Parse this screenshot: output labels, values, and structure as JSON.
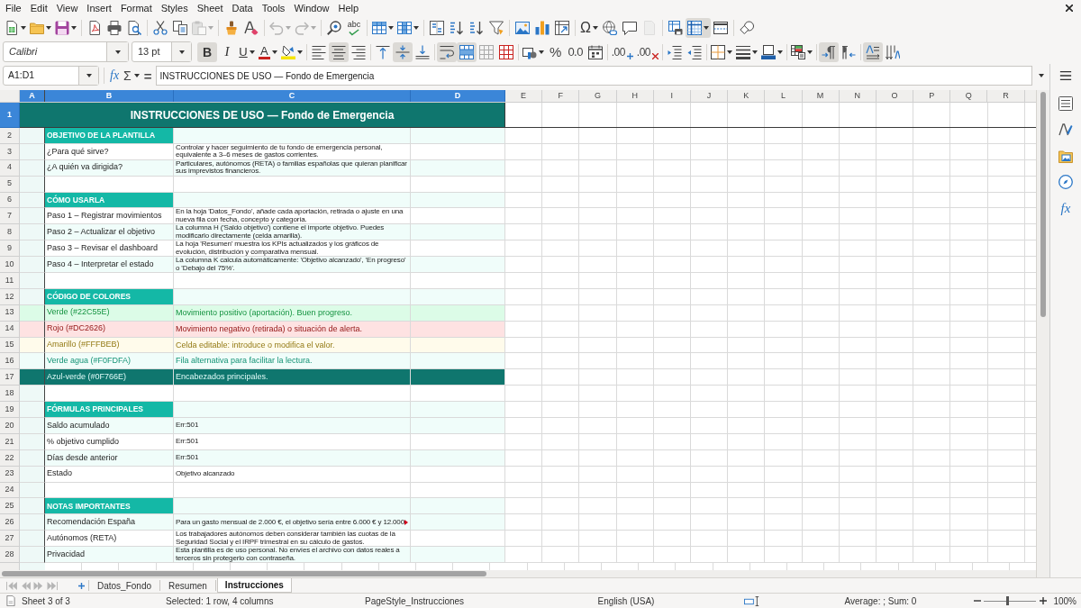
{
  "menu_bar": {
    "items": [
      "File",
      "Edit",
      "View",
      "Insert",
      "Format",
      "Styles",
      "Sheet",
      "Data",
      "Tools",
      "Window",
      "Help"
    ]
  },
  "standard_toolbar": {
    "groups": [
      [
        {
          "kind": "new",
          "dropdown": true,
          "disabled": false,
          "active": false
        },
        {
          "kind": "open",
          "dropdown": true,
          "disabled": false,
          "active": false
        },
        {
          "kind": "save",
          "dropdown": true,
          "disabled": false,
          "active": false
        }
      ],
      [
        {
          "kind": "pdf",
          "dropdown": false,
          "disabled": false,
          "active": false
        },
        {
          "kind": "print",
          "dropdown": false,
          "disabled": false,
          "active": false
        },
        {
          "kind": "preview",
          "dropdown": false,
          "disabled": false,
          "active": false
        }
      ],
      [
        {
          "kind": "cut",
          "dropdown": false,
          "disabled": false,
          "active": false
        },
        {
          "kind": "copy",
          "dropdown": false,
          "disabled": false,
          "active": false
        },
        {
          "kind": "paste",
          "dropdown": true,
          "disabled": true,
          "active": false
        }
      ],
      [
        {
          "kind": "clone",
          "dropdown": false,
          "disabled": false,
          "active": false
        },
        {
          "kind": "clear",
          "dropdown": false,
          "disabled": false,
          "active": false
        }
      ],
      [
        {
          "kind": "undo",
          "dropdown": true,
          "disabled": true,
          "active": false
        },
        {
          "kind": "redo",
          "dropdown": true,
          "disabled": true,
          "active": false
        }
      ],
      [
        {
          "kind": "find",
          "dropdown": false,
          "disabled": false,
          "active": false
        },
        {
          "kind": "spelling",
          "label": "abc",
          "dropdown": false,
          "disabled": false,
          "active": false
        }
      ],
      [
        {
          "kind": "rows",
          "dropdown": true,
          "disabled": false,
          "active": false
        },
        {
          "kind": "columns",
          "dropdown": true,
          "disabled": false,
          "active": false
        }
      ],
      [
        {
          "kind": "sort",
          "dropdown": false,
          "disabled": false,
          "active": false
        },
        {
          "kind": "sortup",
          "dropdown": false,
          "disabled": false,
          "active": false
        },
        {
          "kind": "sortdown",
          "dropdown": false,
          "disabled": false,
          "active": false
        },
        {
          "kind": "filter",
          "dropdown": false,
          "disabled": false,
          "active": false
        }
      ],
      [
        {
          "kind": "image",
          "dropdown": false,
          "disabled": false,
          "active": false
        },
        {
          "kind": "chart",
          "dropdown": false,
          "disabled": false,
          "active": false
        },
        {
          "kind": "pivot",
          "dropdown": false,
          "disabled": false,
          "active": false
        }
      ],
      [
        {
          "kind": "special",
          "label": "Ω",
          "dropdown": true,
          "disabled": false,
          "active": false
        },
        {
          "kind": "hyperlink",
          "dropdown": false,
          "disabled": false,
          "active": false
        },
        {
          "kind": "comment",
          "dropdown": false,
          "disabled": false,
          "active": false
        },
        {
          "kind": "header",
          "dropdown": false,
          "disabled": true,
          "active": false
        }
      ],
      [
        {
          "kind": "printarea",
          "dropdown": false,
          "disabled": false,
          "active": false
        },
        {
          "kind": "freeze",
          "dropdown": true,
          "disabled": false,
          "active": true
        },
        {
          "kind": "split",
          "dropdown": false,
          "disabled": false,
          "active": false
        }
      ],
      [
        {
          "kind": "draw",
          "dropdown": false,
          "disabled": false,
          "active": false
        }
      ]
    ]
  },
  "formatting_toolbar": {
    "font_name": "Calibri",
    "font_size": "13 pt",
    "groups": [
      [
        {
          "kind": "bold",
          "label": "B",
          "dropdown": false,
          "active": true
        },
        {
          "kind": "italic",
          "label": "I",
          "dropdown": false,
          "active": false
        },
        {
          "kind": "underline",
          "label": "U",
          "dropdown": true,
          "active": false
        },
        {
          "kind": "fontcolor",
          "label": "A",
          "dropdown": true,
          "active": false
        },
        {
          "kind": "highlight",
          "dropdown": true,
          "active": false
        }
      ],
      [
        {
          "kind": "alignleft",
          "dropdown": false,
          "active": false
        },
        {
          "kind": "aligncenter",
          "dropdown": false,
          "active": true
        },
        {
          "kind": "alignright",
          "dropdown": false,
          "active": false
        }
      ],
      [
        {
          "kind": "aligntop",
          "dropdown": false,
          "active": false
        },
        {
          "kind": "alignmiddle",
          "dropdown": false,
          "active": true
        },
        {
          "kind": "alignbottom",
          "dropdown": false,
          "active": false
        }
      ],
      [
        {
          "kind": "wrap",
          "dropdown": false,
          "active": true
        },
        {
          "kind": "mergecenter",
          "dropdown": false,
          "active": true
        },
        {
          "kind": "merge",
          "dropdown": false,
          "active": false
        },
        {
          "kind": "unmerge",
          "dropdown": false,
          "active": false
        }
      ],
      [
        {
          "kind": "currency",
          "dropdown": true,
          "active": false
        },
        {
          "kind": "percent",
          "label": "%",
          "dropdown": false,
          "active": false
        },
        {
          "kind": "number",
          "label": "0.0",
          "dropdown": false,
          "active": false
        },
        {
          "kind": "date",
          "dropdown": false,
          "active": false
        }
      ],
      [
        {
          "kind": "adddecimal",
          "label": ".00",
          "dropdown": false,
          "active": false
        },
        {
          "kind": "deldecimal",
          "label": ".00",
          "dropdown": false,
          "active": false
        }
      ],
      [
        {
          "kind": "indent",
          "dropdown": false,
          "active": false
        },
        {
          "kind": "outdent",
          "dropdown": false,
          "active": false
        }
      ],
      [
        {
          "kind": "borders",
          "dropdown": true,
          "active": false
        },
        {
          "kind": "borderstyle",
          "dropdown": true,
          "active": false
        },
        {
          "kind": "bordercolor",
          "dropdown": true,
          "active": false
        }
      ],
      [
        {
          "kind": "conditional",
          "dropdown": true,
          "active": false
        }
      ],
      [
        {
          "kind": "ltr",
          "dropdown": false,
          "active": true
        },
        {
          "kind": "rtl",
          "dropdown": false,
          "active": false
        }
      ],
      [
        {
          "kind": "textltr",
          "dropdown": false,
          "active": true
        },
        {
          "kind": "textttb",
          "dropdown": false,
          "active": false
        }
      ]
    ]
  },
  "formula_bar": {
    "name_box": "A1:D1",
    "wizard_glyph": "fx",
    "sum_glyph": "Σ",
    "formula_glyph": "=",
    "content": "INSTRUCCIONES DE USO — Fondo de Emergencia"
  },
  "sidebar": {
    "functions_glyph": "fx"
  },
  "sheet": {
    "columns": [
      {
        "label": "A",
        "selected": true
      },
      {
        "label": "B",
        "selected": true
      },
      {
        "label": "C",
        "selected": true
      },
      {
        "label": "D",
        "selected": true
      },
      {
        "label": "E",
        "selected": false
      },
      {
        "label": "F",
        "selected": false
      },
      {
        "label": "G",
        "selected": false
      },
      {
        "label": "H",
        "selected": false
      },
      {
        "label": "I",
        "selected": false
      },
      {
        "label": "J",
        "selected": false
      },
      {
        "label": "K",
        "selected": false
      },
      {
        "label": "L",
        "selected": false
      },
      {
        "label": "M",
        "selected": false
      },
      {
        "label": "N",
        "selected": false
      },
      {
        "label": "O",
        "selected": false
      },
      {
        "label": "P",
        "selected": false
      },
      {
        "label": "Q",
        "selected": false
      },
      {
        "label": "R",
        "selected": false
      }
    ],
    "rows": [
      {
        "header": "1",
        "selected": true,
        "kind": "title",
        "text": "INSTRUCCIONES DE USO — Fondo de Emergencia"
      },
      {
        "header": "2",
        "selected": false,
        "kind": "section",
        "shaded": true,
        "b": "OBJETIVO DE LA PLANTILLA"
      },
      {
        "header": "3",
        "selected": false,
        "kind": "item",
        "shaded": false,
        "overflow": false,
        "b": "¿Para qué sirve?",
        "c": "Controlar y hacer seguimiento de tu fondo de emergencia personal, equivalente a 3–6 meses de gastos corrientes."
      },
      {
        "header": "4",
        "selected": false,
        "kind": "item",
        "shaded": true,
        "overflow": false,
        "b": "¿A quién va dirigida?",
        "c": "Particulares, autónomos (RETA) o familias españolas que quieran planificar sus imprevistos financieros."
      },
      {
        "header": "5",
        "selected": false,
        "kind": "blank",
        "shaded": false
      },
      {
        "header": "6",
        "selected": false,
        "kind": "section",
        "shaded": true,
        "b": "CÓMO USARLA"
      },
      {
        "header": "7",
        "selected": false,
        "kind": "item",
        "shaded": false,
        "overflow": false,
        "b": "Paso 1 – Registrar movimientos",
        "c": "En la hoja 'Datos_Fondo', añade cada aportación, retirada o ajuste en una nueva fila con fecha, concepto y categoría."
      },
      {
        "header": "8",
        "selected": false,
        "kind": "item",
        "shaded": true,
        "overflow": false,
        "b": "Paso 2 – Actualizar el objetivo",
        "c": "La columna H ('Saldo objetivo') contiene el importe objetivo. Puedes modificarlo directamente (celda amarilla)."
      },
      {
        "header": "9",
        "selected": false,
        "kind": "item",
        "shaded": false,
        "overflow": false,
        "b": "Paso 3 – Revisar el dashboard",
        "c": "La hoja 'Resumen' muestra los KPIs actualizados y los gráficos de evolución, distribución y comparativa mensual."
      },
      {
        "header": "10",
        "selected": false,
        "kind": "item",
        "shaded": true,
        "overflow": false,
        "b": "Paso 4 – Interpretar el estado",
        "c": "La columna K calcula automáticamente: 'Objetivo alcanzado', 'En progreso' o 'Debajo del 75%'."
      },
      {
        "header": "11",
        "selected": false,
        "kind": "blank",
        "shaded": false
      },
      {
        "header": "12",
        "selected": false,
        "kind": "section",
        "shaded": true,
        "b": "CÓDIGO DE COLORES"
      },
      {
        "header": "13",
        "selected": false,
        "kind": "swatch",
        "color": "#dcfce7",
        "b": "Verde (#22C55E)",
        "c": "Movimiento positivo (aportación). Buen progreso."
      },
      {
        "header": "14",
        "selected": false,
        "kind": "swatch",
        "color": "#fee2e2",
        "b": "Rojo (#DC2626)",
        "c": "Movimiento negativo (retirada) o situación de alerta."
      },
      {
        "header": "15",
        "selected": false,
        "kind": "swatch",
        "color": "#fffbeb",
        "b": "Amarillo (#FFFBEB)",
        "c": "Celda editable: introduce o modifica el valor."
      },
      {
        "header": "16",
        "selected": false,
        "kind": "swatch",
        "color": "#f0fdfa",
        "b": "Verde agua (#F0FDFA)",
        "c": "Fila alternativa para facilitar la lectura."
      },
      {
        "header": "17",
        "selected": false,
        "kind": "swatch",
        "color": "#0f766e",
        "b": "Azul-verde (#0F766E)",
        "c": "Encabezados principales."
      },
      {
        "header": "18",
        "selected": false,
        "kind": "blank",
        "shaded": false
      },
      {
        "header": "19",
        "selected": false,
        "kind": "section",
        "shaded": true,
        "b": "FÓRMULAS PRINCIPALES"
      },
      {
        "header": "20",
        "selected": false,
        "kind": "item",
        "shaded": true,
        "overflow": false,
        "b": "Saldo acumulado",
        "c": "Err:501"
      },
      {
        "header": "21",
        "selected": false,
        "kind": "item",
        "shaded": false,
        "overflow": false,
        "b": "% objetivo cumplido",
        "c": "Err:501"
      },
      {
        "header": "22",
        "selected": false,
        "kind": "item",
        "shaded": true,
        "overflow": false,
        "b": "Días desde anterior",
        "c": "Err:501"
      },
      {
        "header": "23",
        "selected": false,
        "kind": "item",
        "shaded": false,
        "overflow": false,
        "b": "Estado",
        "c": "Objetivo alcanzado"
      },
      {
        "header": "24",
        "selected": false,
        "kind": "blank",
        "shaded": false
      },
      {
        "header": "25",
        "selected": false,
        "kind": "section",
        "shaded": true,
        "b": "NOTAS IMPORTANTES"
      },
      {
        "header": "26",
        "selected": false,
        "kind": "item",
        "shaded": true,
        "overflow": true,
        "b": "Recomendación España",
        "c": "Para un gasto mensual de 2.000 €, el objetivo sería entre 6.000 € y 12.000"
      },
      {
        "header": "27",
        "selected": false,
        "kind": "item",
        "shaded": false,
        "overflow": false,
        "b": "Autónomos (RETA)",
        "c": "Los trabajadores autónomos deben considerar también las cuotas de la Seguridad Social y el IRPF trimestral en su cálculo de gastos."
      },
      {
        "header": "28",
        "selected": false,
        "kind": "item",
        "shaded": true,
        "overflow": false,
        "b": "Privacidad",
        "c": "Esta plantilla es de uso personal. No envíes el archivo con datos reales a terceros sin protegerlo con contraseña."
      }
    ]
  },
  "sheet_tabs": {
    "nav_disabled": true,
    "tabs": [
      {
        "label": "Datos_Fondo",
        "selected": false
      },
      {
        "label": "Resumen",
        "selected": false
      },
      {
        "label": "Instrucciones",
        "selected": true
      }
    ]
  },
  "status_bar": {
    "sheet": "Sheet 3 of 3",
    "selection": "Selected: 1 row, 4 columns",
    "page_style": "PageStyle_Instrucciones",
    "language": "English (USA)",
    "summary": "Average: ; Sum: 0",
    "zoom": {
      "level": 0.46,
      "value": "100%"
    }
  }
}
